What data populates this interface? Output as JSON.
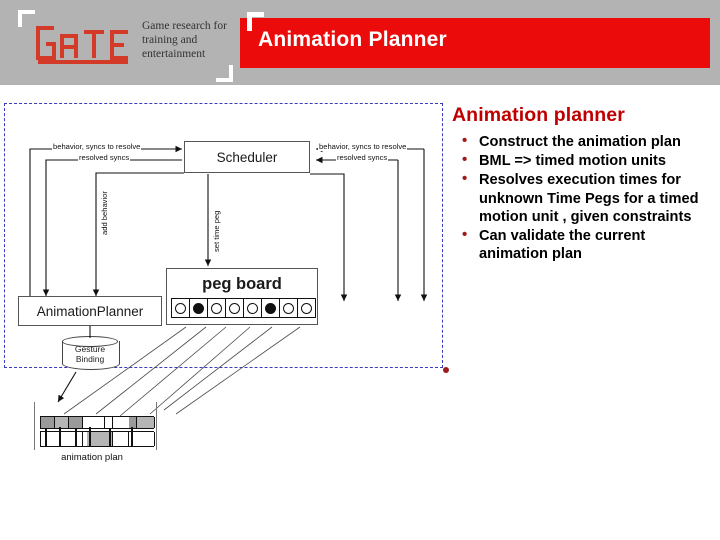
{
  "header": {
    "logo_mark_text": "GATE",
    "logo_tagline": "Game research for training and entertainment",
    "title": "Animation Planner",
    "band_color": "#b3b3b3",
    "title_bar_color": "#ec0b0b"
  },
  "content": {
    "heading": "Animation planner",
    "heading_color": "#c00000",
    "bullets": [
      "Construct the animation plan",
      "BML => timed motion units",
      "Resolves execution times for unknown Time Pegs for a timed motion unit , given constraints",
      "Can validate the current animation plan"
    ]
  },
  "diagram": {
    "boundary_color": "#3b3bbf",
    "nodes": {
      "scheduler": "Scheduler",
      "animation_planner": "AnimationPlanner",
      "peg_board": "peg board",
      "gesture_binding_line1": "Gesture",
      "gesture_binding_line2": "Binding",
      "animation_plan": "animation plan"
    },
    "edge_labels": {
      "behavior_syncs_left": "behavior, syncs to resolve",
      "resolved_syncs_left": "resolved syncs",
      "behavior_syncs_right": "behavior, syncs to resolve",
      "resolved_syncs_right": "resolved syncs",
      "add_behavior": "add behavior",
      "set_time_peg": "set time peg"
    },
    "peg_board_cells": [
      {
        "filled": false
      },
      {
        "filled": true
      },
      {
        "filled": false
      },
      {
        "filled": false
      },
      {
        "filled": false
      },
      {
        "filled": true
      },
      {
        "filled": false
      },
      {
        "filled": false
      }
    ]
  }
}
